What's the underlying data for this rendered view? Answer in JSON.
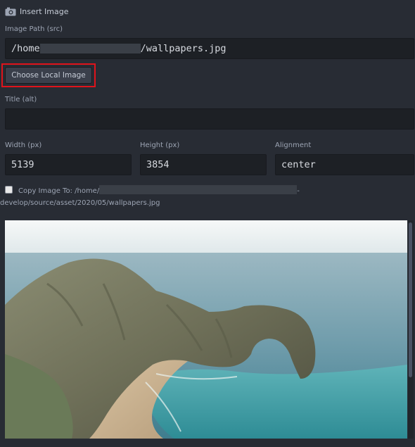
{
  "dialog": {
    "title": "Insert Image",
    "icon": "camera-icon"
  },
  "image_path": {
    "label": "Image Path (src)",
    "value_prefix": "/home",
    "value_suffix": "/wallpapers.jpg"
  },
  "choose_button": {
    "label": "Choose Local Image"
  },
  "title_alt": {
    "label": "Title (alt)",
    "value": ""
  },
  "width": {
    "label": "Width (px)",
    "value": "5139"
  },
  "height": {
    "label": "Height (px)",
    "value": "3854"
  },
  "alignment": {
    "label": "Alignment",
    "value": "center"
  },
  "copy": {
    "checked": false,
    "label": "Copy Image To: /home/",
    "path_tail": "-",
    "path_line2": "develop/source/asset/2020/05/wallpapers.jpg"
  },
  "preview": {
    "alt": "coastal rock arch over turquoise sea"
  },
  "colors": {
    "highlight": "#e0131b",
    "background": "#282c34",
    "field": "#1d2025"
  }
}
